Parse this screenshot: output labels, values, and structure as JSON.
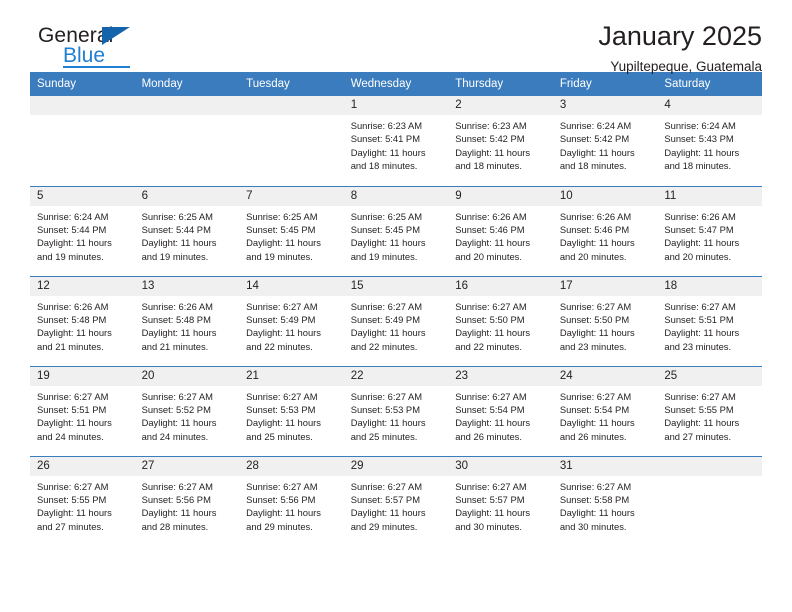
{
  "brand": {
    "name_top": "General",
    "name_bottom": "Blue",
    "logo_icon": "triangle-flag-icon",
    "accent_color": "#1f7fd0",
    "flag_color": "#1464ac"
  },
  "header": {
    "title": "January 2025",
    "subtitle": "Yupiltepeque, Guatemala"
  },
  "calendar": {
    "header_bg": "#3b7cbe",
    "daynum_bg": "#f0f0f0",
    "weekdays": [
      "Sunday",
      "Monday",
      "Tuesday",
      "Wednesday",
      "Thursday",
      "Friday",
      "Saturday"
    ],
    "weeks": [
      [
        {
          "day": "",
          "empty": true
        },
        {
          "day": "",
          "empty": true
        },
        {
          "day": "",
          "empty": true
        },
        {
          "day": "1",
          "sunrise": "Sunrise: 6:23 AM",
          "sunset": "Sunset: 5:41 PM",
          "daylight": "Daylight: 11 hours and 18 minutes."
        },
        {
          "day": "2",
          "sunrise": "Sunrise: 6:23 AM",
          "sunset": "Sunset: 5:42 PM",
          "daylight": "Daylight: 11 hours and 18 minutes."
        },
        {
          "day": "3",
          "sunrise": "Sunrise: 6:24 AM",
          "sunset": "Sunset: 5:42 PM",
          "daylight": "Daylight: 11 hours and 18 minutes."
        },
        {
          "day": "4",
          "sunrise": "Sunrise: 6:24 AM",
          "sunset": "Sunset: 5:43 PM",
          "daylight": "Daylight: 11 hours and 18 minutes."
        }
      ],
      [
        {
          "day": "5",
          "sunrise": "Sunrise: 6:24 AM",
          "sunset": "Sunset: 5:44 PM",
          "daylight": "Daylight: 11 hours and 19 minutes."
        },
        {
          "day": "6",
          "sunrise": "Sunrise: 6:25 AM",
          "sunset": "Sunset: 5:44 PM",
          "daylight": "Daylight: 11 hours and 19 minutes."
        },
        {
          "day": "7",
          "sunrise": "Sunrise: 6:25 AM",
          "sunset": "Sunset: 5:45 PM",
          "daylight": "Daylight: 11 hours and 19 minutes."
        },
        {
          "day": "8",
          "sunrise": "Sunrise: 6:25 AM",
          "sunset": "Sunset: 5:45 PM",
          "daylight": "Daylight: 11 hours and 19 minutes."
        },
        {
          "day": "9",
          "sunrise": "Sunrise: 6:26 AM",
          "sunset": "Sunset: 5:46 PM",
          "daylight": "Daylight: 11 hours and 20 minutes."
        },
        {
          "day": "10",
          "sunrise": "Sunrise: 6:26 AM",
          "sunset": "Sunset: 5:46 PM",
          "daylight": "Daylight: 11 hours and 20 minutes."
        },
        {
          "day": "11",
          "sunrise": "Sunrise: 6:26 AM",
          "sunset": "Sunset: 5:47 PM",
          "daylight": "Daylight: 11 hours and 20 minutes."
        }
      ],
      [
        {
          "day": "12",
          "sunrise": "Sunrise: 6:26 AM",
          "sunset": "Sunset: 5:48 PM",
          "daylight": "Daylight: 11 hours and 21 minutes."
        },
        {
          "day": "13",
          "sunrise": "Sunrise: 6:26 AM",
          "sunset": "Sunset: 5:48 PM",
          "daylight": "Daylight: 11 hours and 21 minutes."
        },
        {
          "day": "14",
          "sunrise": "Sunrise: 6:27 AM",
          "sunset": "Sunset: 5:49 PM",
          "daylight": "Daylight: 11 hours and 22 minutes."
        },
        {
          "day": "15",
          "sunrise": "Sunrise: 6:27 AM",
          "sunset": "Sunset: 5:49 PM",
          "daylight": "Daylight: 11 hours and 22 minutes."
        },
        {
          "day": "16",
          "sunrise": "Sunrise: 6:27 AM",
          "sunset": "Sunset: 5:50 PM",
          "daylight": "Daylight: 11 hours and 22 minutes."
        },
        {
          "day": "17",
          "sunrise": "Sunrise: 6:27 AM",
          "sunset": "Sunset: 5:50 PM",
          "daylight": "Daylight: 11 hours and 23 minutes."
        },
        {
          "day": "18",
          "sunrise": "Sunrise: 6:27 AM",
          "sunset": "Sunset: 5:51 PM",
          "daylight": "Daylight: 11 hours and 23 minutes."
        }
      ],
      [
        {
          "day": "19",
          "sunrise": "Sunrise: 6:27 AM",
          "sunset": "Sunset: 5:51 PM",
          "daylight": "Daylight: 11 hours and 24 minutes."
        },
        {
          "day": "20",
          "sunrise": "Sunrise: 6:27 AM",
          "sunset": "Sunset: 5:52 PM",
          "daylight": "Daylight: 11 hours and 24 minutes."
        },
        {
          "day": "21",
          "sunrise": "Sunrise: 6:27 AM",
          "sunset": "Sunset: 5:53 PM",
          "daylight": "Daylight: 11 hours and 25 minutes."
        },
        {
          "day": "22",
          "sunrise": "Sunrise: 6:27 AM",
          "sunset": "Sunset: 5:53 PM",
          "daylight": "Daylight: 11 hours and 25 minutes."
        },
        {
          "day": "23",
          "sunrise": "Sunrise: 6:27 AM",
          "sunset": "Sunset: 5:54 PM",
          "daylight": "Daylight: 11 hours and 26 minutes."
        },
        {
          "day": "24",
          "sunrise": "Sunrise: 6:27 AM",
          "sunset": "Sunset: 5:54 PM",
          "daylight": "Daylight: 11 hours and 26 minutes."
        },
        {
          "day": "25",
          "sunrise": "Sunrise: 6:27 AM",
          "sunset": "Sunset: 5:55 PM",
          "daylight": "Daylight: 11 hours and 27 minutes."
        }
      ],
      [
        {
          "day": "26",
          "sunrise": "Sunrise: 6:27 AM",
          "sunset": "Sunset: 5:55 PM",
          "daylight": "Daylight: 11 hours and 27 minutes."
        },
        {
          "day": "27",
          "sunrise": "Sunrise: 6:27 AM",
          "sunset": "Sunset: 5:56 PM",
          "daylight": "Daylight: 11 hours and 28 minutes."
        },
        {
          "day": "28",
          "sunrise": "Sunrise: 6:27 AM",
          "sunset": "Sunset: 5:56 PM",
          "daylight": "Daylight: 11 hours and 29 minutes."
        },
        {
          "day": "29",
          "sunrise": "Sunrise: 6:27 AM",
          "sunset": "Sunset: 5:57 PM",
          "daylight": "Daylight: 11 hours and 29 minutes."
        },
        {
          "day": "30",
          "sunrise": "Sunrise: 6:27 AM",
          "sunset": "Sunset: 5:57 PM",
          "daylight": "Daylight: 11 hours and 30 minutes."
        },
        {
          "day": "31",
          "sunrise": "Sunrise: 6:27 AM",
          "sunset": "Sunset: 5:58 PM",
          "daylight": "Daylight: 11 hours and 30 minutes."
        },
        {
          "day": "",
          "empty": true
        }
      ]
    ]
  }
}
